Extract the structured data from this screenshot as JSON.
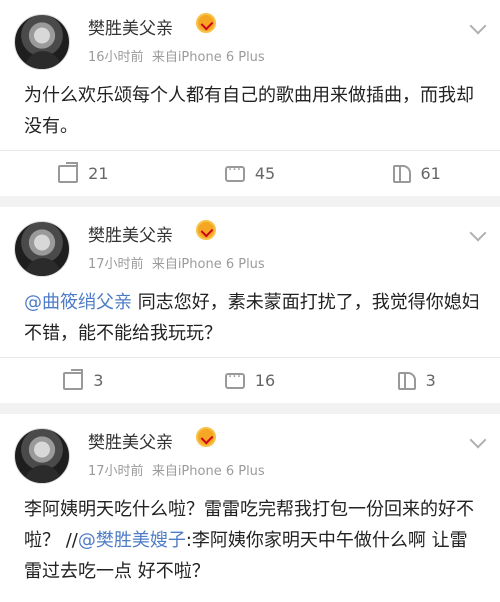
{
  "posts": [
    {
      "author": "樊胜美父亲",
      "time": "16小时前",
      "source": "来自iPhone 6 Plus",
      "text_parts": {
        "a": "为什么欢乐颂每个人都有自己的歌曲用来做插曲，而我却没有。"
      },
      "reposts": "21",
      "comments": "45",
      "likes": "61"
    },
    {
      "author": "樊胜美父亲",
      "time": "17小时前",
      "source": "来自iPhone 6 Plus",
      "text_parts": {
        "mention": "@曲筱绡父亲",
        "b": " 同志您好，素未蒙面打扰了，我觉得你媳妇不错，能不能给我玩玩？"
      },
      "reposts": "3",
      "comments": "16",
      "likes": "3"
    },
    {
      "author": "樊胜美父亲",
      "time": "17小时前",
      "source": "来自iPhone 6 Plus",
      "text_parts": {
        "a": "李阿姨明天吃什么啦？雷雷吃完帮我打包一份回来的好不啦？ //",
        "mention": "@樊胜美嫂子",
        "b": ":李阿姨你家明天中午做什么啊 让雷雷过去吃一点 好不啦？"
      }
    }
  ],
  "colors": {
    "mention": "#4f7cc7",
    "vip_badge": "#f5a623"
  }
}
